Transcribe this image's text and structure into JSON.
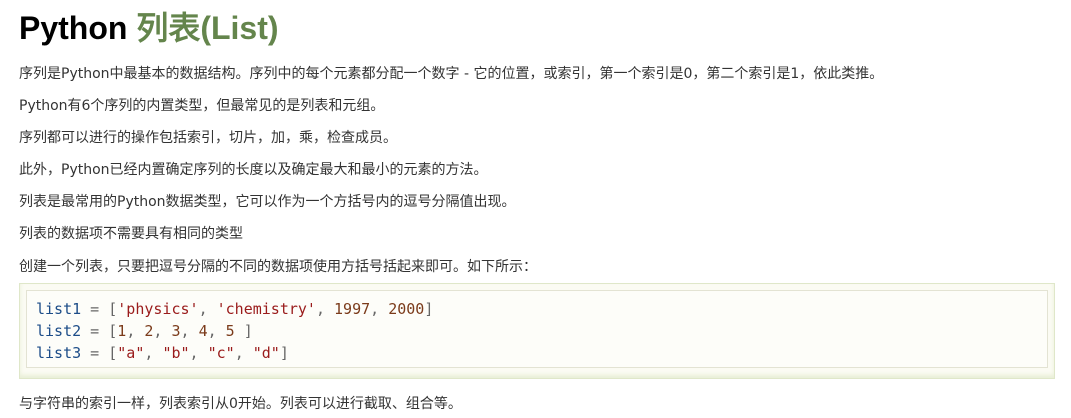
{
  "title": {
    "prefix": "Python ",
    "accent": "列表(List)"
  },
  "paragraphs": {
    "p1": "序列是Python中最基本的数据结构。序列中的每个元素都分配一个数字 - 它的位置，或索引，第一个索引是0，第二个索引是1，依此类推。",
    "p2": "Python有6个序列的内置类型，但最常见的是列表和元组。",
    "p3": "序列都可以进行的操作包括索引，切片，加，乘，检查成员。",
    "p4": "此外，Python已经内置确定序列的长度以及确定最大和最小的元素的方法。",
    "p5": "列表是最常用的Python数据类型，它可以作为一个方括号内的逗号分隔值出现。",
    "p6": "列表的数据项不需要具有相同的类型",
    "p7": "创建一个列表，只要把逗号分隔的不同的数据项使用方括号括起来即可。如下所示：",
    "p8": "与字符串的索引一样，列表索引从0开始。列表可以进行截取、组合等。"
  },
  "code": {
    "line1": {
      "var": "list1",
      "eq": " = ",
      "open": "[",
      "s1": "'physics'",
      "c1": ", ",
      "s2": "'chemistry'",
      "c2": ", ",
      "n1": "1997",
      "c3": ", ",
      "n2": "2000",
      "close": "]"
    },
    "line2": {
      "var": "list2",
      "eq": " = ",
      "open": "[",
      "n1": "1",
      "c1": ", ",
      "n2": "2",
      "c2": ", ",
      "n3": "3",
      "c3": ", ",
      "n4": "4",
      "c4": ", ",
      "n5": "5",
      "close": " ]"
    },
    "line3": {
      "var": "list3",
      "eq": " = ",
      "open": "[",
      "s1": "\"a\"",
      "c1": ", ",
      "s2": "\"b\"",
      "c2": ", ",
      "s3": "\"c\"",
      "c3": ", ",
      "s4": "\"d\"",
      "close": "]"
    }
  },
  "colors": {
    "title_accent": "#64854c",
    "body_text": "#333333",
    "code_bg": "#fbfbf3",
    "code_border": "#dfe7c9"
  }
}
